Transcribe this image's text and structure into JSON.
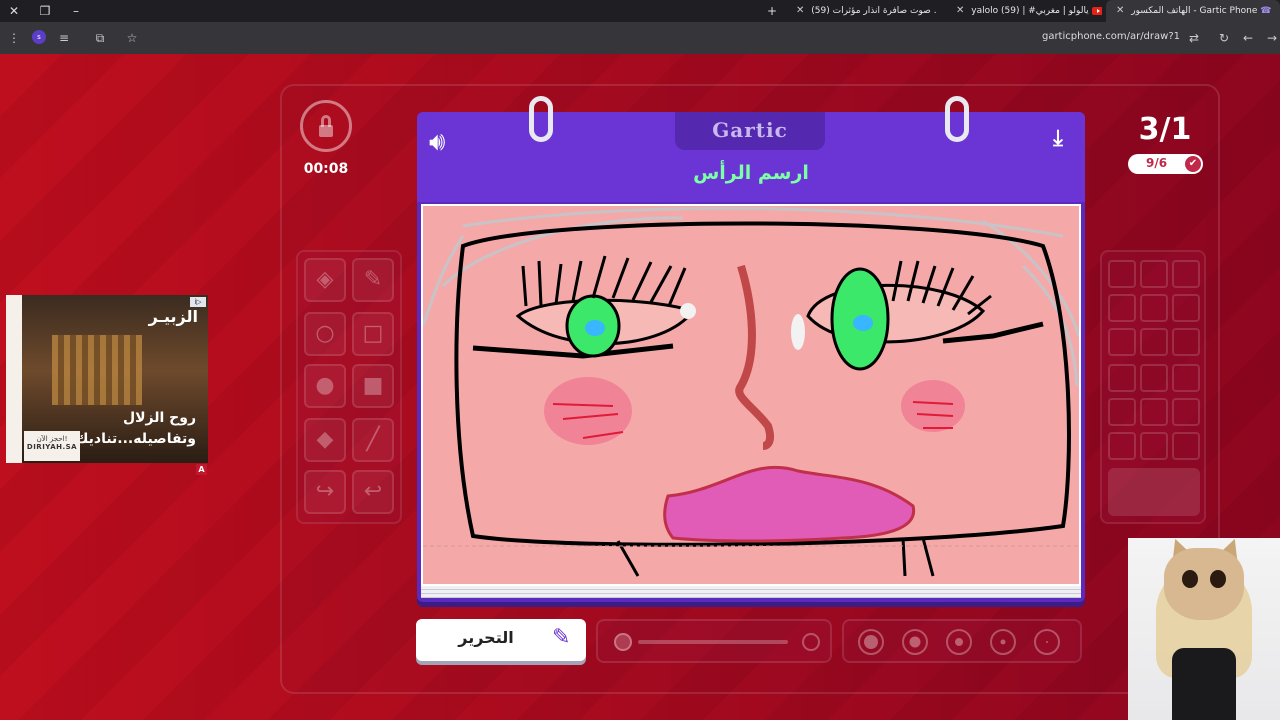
{
  "browser": {
    "tabs": [
      {
        "title": "الهاتف المكسور - Gartic Phone",
        "active": true
      },
      {
        "title": "yalolo (59) | #يالولو | مغربي",
        "active": false
      },
      {
        "title": "(59) صوت صافرة انذار مؤثرات ...",
        "active": false
      }
    ],
    "url": "garticphone.com/ar/draw?1"
  },
  "game": {
    "timer": "00:08",
    "round": "3/1",
    "done_count": "9/6",
    "logo": "Gartic",
    "prompt": "ارسم الرأس",
    "edit_label": "التحرير"
  },
  "ad": {
    "brand": "الزبيـر",
    "line1": "روح الزلال",
    "line2": "وتفاصيله...تناديك",
    "cta": "احجز الآن!",
    "domain": "DIRIYAH.SA",
    "badge": "A"
  },
  "colors": {
    "prompt": "#7dffa6",
    "notebook": "#6a35d4",
    "canvas_bg": "#f4a9a8",
    "page_bg": "#d93a55"
  },
  "icons": [
    "lock-icon",
    "speaker-icon",
    "download-icon",
    "pen-icon",
    "check-icon",
    "bucket-icon",
    "pencil-icon",
    "circle-outline-icon",
    "square-outline-icon",
    "circle-fill-icon",
    "square-fill-icon",
    "eraser-icon",
    "line-icon",
    "undo-icon",
    "redo-icon"
  ]
}
